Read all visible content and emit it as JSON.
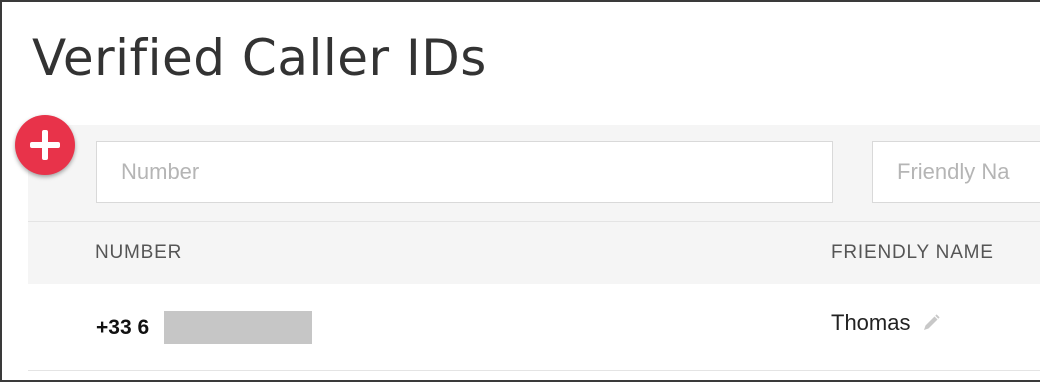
{
  "page": {
    "title": "Verified Caller IDs"
  },
  "filters": {
    "number_placeholder": "Number",
    "friendly_placeholder": "Friendly Na",
    "number_value": "",
    "friendly_value": ""
  },
  "add_button": {
    "icon": "plus-icon",
    "color": "#e8334a"
  },
  "table": {
    "columns": [
      "NUMBER",
      "FRIENDLY NAME"
    ],
    "rows": [
      {
        "number": "+33 6",
        "number_redacted": true,
        "friendly_name": "Thomas",
        "edit_icon": "pencil-icon"
      }
    ]
  }
}
